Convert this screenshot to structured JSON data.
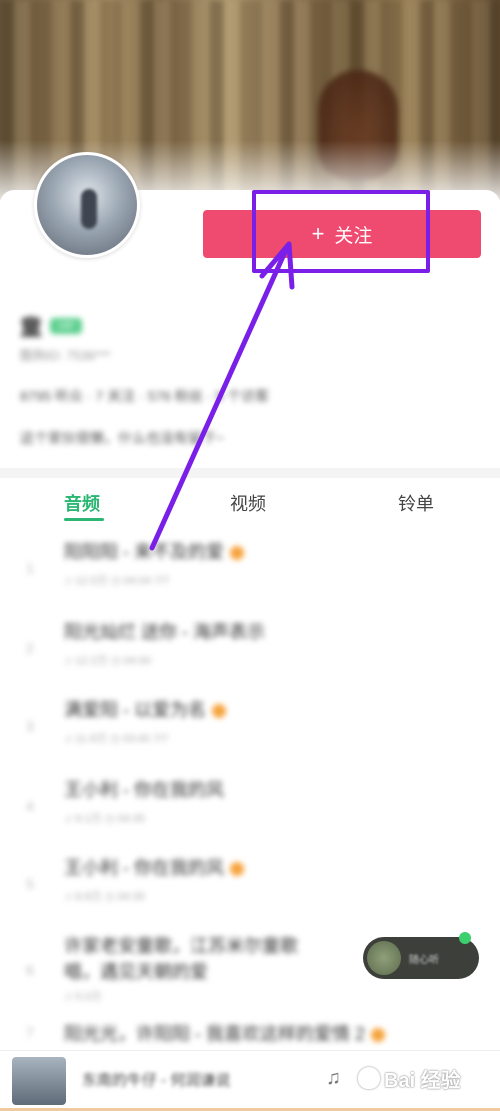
{
  "profile": {
    "name": "童",
    "badge": "VIP",
    "sub_id": "酷狗ID: 7536***",
    "stats": "8795 听众 · 7 关注 · 576 粉丝 · 5 个访客",
    "bio": "这个家伙很懒，什么也没有留下~",
    "follow_label": "关注"
  },
  "tabs": [
    {
      "label": "音频",
      "active": true
    },
    {
      "label": "视频",
      "active": false
    },
    {
      "label": "铃单",
      "active": false
    }
  ],
  "tracks": [
    {
      "num": "1",
      "title": "阳阳阳 - 来不及的爱",
      "meta": "♫ 12.5万  ◷ 04:04  7/7",
      "hot": true
    },
    {
      "num": "2",
      "title": "阳光灿烂 送你 - 海声表示",
      "meta": "♫ 12.2万  ◷ 04:00",
      "hot": false
    },
    {
      "num": "3",
      "title": "满爱阳 - 以爱为名",
      "meta": "♫ 11.9万  ◷ 03:40  7/7",
      "hot": true
    },
    {
      "num": "4",
      "title": "王小利 - 你在我的风",
      "meta": "♫ 9.1万  ◷ 04:35",
      "hot": false
    },
    {
      "num": "5",
      "title": "王小利 - 你在我的风",
      "meta": "♫ 8.8万  ◷ 04:35",
      "hot": true
    },
    {
      "num": "6",
      "title": "许家老安童歌，江苏米尔童歌",
      "title2": "唱，遇见天朝的爱",
      "meta": "♫ 5.0万",
      "hot": false
    },
    {
      "num": "7",
      "title": "阳光光，许阳阳 - 我喜欢这样的爱情 2",
      "meta": "",
      "hot": true
    }
  ],
  "mini_player": {
    "text": "随心听"
  },
  "now_playing": {
    "title": "东南的牛仔 - 何润谦说"
  },
  "watermark": {
    "text": "Bai 经验"
  },
  "colors": {
    "accent": "#2bb673",
    "follow": "#ef4a6f",
    "highlight": "#7a1fe8"
  }
}
